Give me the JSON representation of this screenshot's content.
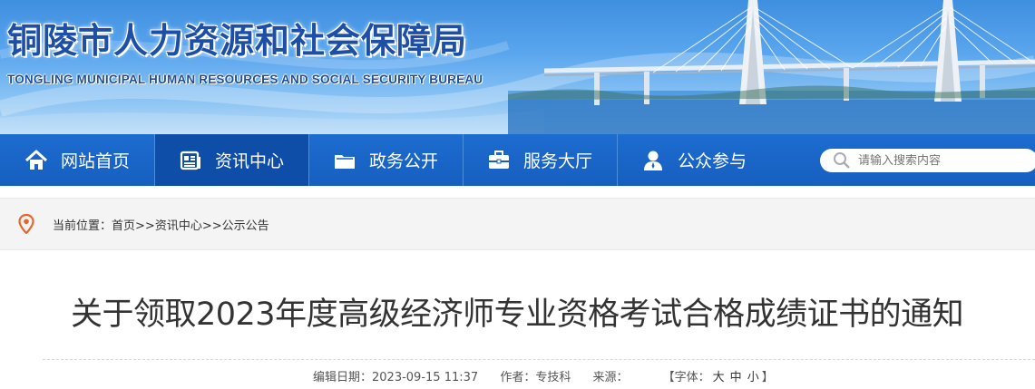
{
  "banner": {
    "title": "铜陵市人力资源和社会保障局",
    "subtitle": "TONGLING MUNICIPAL HUMAN RESOURCES AND SOCIAL SECURITY BUREAU"
  },
  "nav": {
    "items": [
      {
        "label": "网站首页",
        "icon": "home-icon"
      },
      {
        "label": "资讯中心",
        "icon": "newspaper-icon",
        "active": true
      },
      {
        "label": "政务公开",
        "icon": "folder-icon"
      },
      {
        "label": "服务大厅",
        "icon": "briefcase-icon"
      },
      {
        "label": "公众参与",
        "icon": "user-icon"
      }
    ],
    "search_placeholder": "请输入搜索内容"
  },
  "breadcrumb": {
    "prefix": "当前位置：",
    "items": [
      "首页",
      "资讯中心",
      "公示公告"
    ],
    "separator": ">>"
  },
  "article": {
    "title": "关于领取2023年度高级经济师专业资格考试合格成绩证书的通知",
    "edit_date_label": "编辑日期：",
    "edit_date": "2023-09-15 11:37",
    "author_label": "作者：",
    "author": "专技科",
    "source_label": "来源：",
    "source": "",
    "font_label_open": "【字体：",
    "font_large": "大",
    "font_medium": "中",
    "font_small": "小",
    "font_label_close": "】"
  },
  "colors": {
    "nav_bg": "#1d6cd0",
    "nav_active": "#0f4ea8",
    "title_blue": "#1d4fa8",
    "pin_orange": "#e8642c"
  }
}
